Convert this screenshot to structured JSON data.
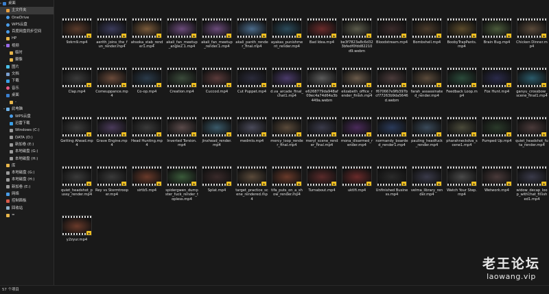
{
  "sidebar": {
    "items": [
      {
        "label": "桌面",
        "icon": "desktop-icon",
        "indent": 0,
        "selected": false,
        "expanded": true
      },
      {
        "label": "主文件夹",
        "icon": "home-folder-icon",
        "indent": 1,
        "selected": true
      },
      {
        "label": "OneDrive",
        "icon": "cloud-icon",
        "indent": 1,
        "selected": false
      },
      {
        "label": "WPS云盘",
        "icon": "cloud-icon",
        "indent": 1,
        "selected": false
      },
      {
        "label": "百度网盘同步空间",
        "icon": "cloud-icon",
        "indent": 1,
        "selected": false
      },
      {
        "label": "HP",
        "icon": "user-folder-icon",
        "indent": 1,
        "selected": false
      },
      {
        "label": "视频",
        "icon": "video-folder-icon",
        "indent": 1,
        "selected": false,
        "expanded": true
      },
      {
        "label": "临时",
        "icon": "folder-icon",
        "indent": 2,
        "selected": false
      },
      {
        "label": "摄像",
        "icon": "folder-icon",
        "indent": 2,
        "selected": false
      },
      {
        "label": "图片",
        "icon": "pictures-icon",
        "indent": 1,
        "selected": false
      },
      {
        "label": "文档",
        "icon": "documents-icon",
        "indent": 1,
        "selected": false
      },
      {
        "label": "下载",
        "icon": "download-icon",
        "indent": 1,
        "selected": false
      },
      {
        "label": "音乐",
        "icon": "music-icon",
        "indent": 1,
        "selected": false
      },
      {
        "label": "桌面",
        "icon": "desktop-icon",
        "indent": 1,
        "selected": false
      },
      {
        "label": "-",
        "icon": "folder-icon",
        "indent": 2,
        "selected": false
      },
      {
        "label": "此电脑",
        "icon": "computer-icon",
        "indent": 1,
        "selected": false,
        "expanded": true
      },
      {
        "label": "WPS云盘",
        "icon": "cloud-icon",
        "indent": 2,
        "selected": false
      },
      {
        "label": "迅雷下载",
        "icon": "download-icon",
        "indent": 2,
        "selected": false
      },
      {
        "label": "Windows (C:)",
        "icon": "drive-icon",
        "indent": 2,
        "selected": false
      },
      {
        "label": "DATA (D:)",
        "icon": "drive-icon",
        "indent": 2,
        "selected": false
      },
      {
        "label": "新加卷 (E:)",
        "icon": "drive-icon",
        "indent": 2,
        "selected": false
      },
      {
        "label": "本地磁盘 (G:)",
        "icon": "drive-icon",
        "indent": 2,
        "selected": false
      },
      {
        "label": "本地磁盘 (H:)",
        "icon": "drive-icon",
        "indent": 2,
        "selected": false
      },
      {
        "label": "库",
        "icon": "library-icon",
        "indent": 1,
        "selected": false
      },
      {
        "label": "本地磁盘 (G:)",
        "icon": "drive-icon",
        "indent": 1,
        "selected": false
      },
      {
        "label": "本地磁盘 (H:)",
        "icon": "drive-icon",
        "indent": 1,
        "selected": false
      },
      {
        "label": "新加卷 (E:)",
        "icon": "drive-icon",
        "indent": 1,
        "selected": false
      },
      {
        "label": "网络",
        "icon": "network-icon",
        "indent": 1,
        "selected": false
      },
      {
        "label": "控制面板",
        "icon": "control-panel-icon",
        "indent": 1,
        "selected": false
      },
      {
        "label": "回收站",
        "icon": "recycle-bin-icon",
        "indent": 1,
        "selected": false
      },
      {
        "label": "=",
        "icon": "folder-icon",
        "indent": 1,
        "selected": false
      }
    ]
  },
  "files": [
    {
      "name": "9zkrn9.mp4",
      "tint": "#5a3a2a"
    },
    {
      "name": "aerith_joins_the_fun_render.mp4",
      "tint": "#3a3a5a"
    },
    {
      "name": "ahsoka_stab_render1.mp4",
      "tint": "#7a5a3a"
    },
    {
      "name": "akali_fan_meetup_angle2.1.mp4",
      "tint": "#6a4a7a"
    },
    {
      "name": "akali_fan_meetup_render.1.mp4",
      "tint": "#6a4a7a"
    },
    {
      "name": "akali_panth_render_final.mp4",
      "tint": "#4a6a8a"
    },
    {
      "name": "ayakas_punishment_render.mp4",
      "tint": "#2a4a5a"
    },
    {
      "name": "Bad Idea.mp4",
      "tint": "#6a2a2a"
    },
    {
      "name": "be3f7823a8c6d323bfedf0fdd82210d9.webm",
      "tint": "#5a5a4a"
    },
    {
      "name": "Bloodstream.mp4",
      "tint": "#3a2a2a"
    },
    {
      "name": "Bombshell.mp4",
      "tint": "#4a3a2a"
    },
    {
      "name": "BoobyTrapPants.mp4",
      "tint": "#5a4a2a"
    },
    {
      "name": "Brain Bug.mp4",
      "tint": "#4a5a3a"
    },
    {
      "name": "Chicken Dinner.mp4",
      "tint": "#5a4a3a"
    },
    {
      "name": "Clap.mp4",
      "tint": "#3a3a3a"
    },
    {
      "name": "Comeuppance.mp4",
      "tint": "#6a4a3a"
    },
    {
      "name": "Co-op.mp4",
      "tint": "#2a3a4a"
    },
    {
      "name": "Creation.mp4",
      "tint": "#3a4a3a"
    },
    {
      "name": "Cuccod.mp4",
      "tint": "#5a3a3a"
    },
    {
      "name": "Cut Puppet.mp4",
      "tint": "#2a2a3a"
    },
    {
      "name": "d.va_arcade_final_chat1.mp4",
      "tint": "#4a3a6a"
    },
    {
      "name": "e6268779da948af09ec4a74d64a3b449a.webm",
      "tint": "#5a5a5a"
    },
    {
      "name": "elizabeth_office_render_finish.mp4",
      "tint": "#6a5a4a"
    },
    {
      "name": "f670667e9fb397bcf77263b9da5646d.webm",
      "tint": "#4a3a3a"
    },
    {
      "name": "farah_assassinated_render.mp4",
      "tint": "#5a4a3a"
    },
    {
      "name": "Feedback Loop.mp4",
      "tint": "#2a4a3a"
    },
    {
      "name": "Fox Hunt.mp4",
      "tint": "#2a2a4a"
    },
    {
      "name": "ganyu_crossbow_scene_final1.mp4",
      "tint": "#2a5a6a"
    },
    {
      "name": "Getting Ahead.mp4",
      "tint": "#3a3a3a"
    },
    {
      "name": "Grave Engine.mp4",
      "tint": "#4a3a5a"
    },
    {
      "name": "Head Hunting.mp4",
      "tint": "#3a3a3a"
    },
    {
      "name": "Inverted Torsion.mp4",
      "tint": "#5a4a4a"
    },
    {
      "name": "jinxhead_render.mp4",
      "tint": "#3a5a6a"
    },
    {
      "name": "medmlo.mp4",
      "tint": "#4a4a5a"
    },
    {
      "name": "mercy_loop_render_final.mp4",
      "tint": "#5a4a3a"
    },
    {
      "name": "meryl_scene_render_final.mp4",
      "tint": "#3a3a4a"
    },
    {
      "name": "mona_disarmed_render.mp4",
      "tint": "#4a2a5a"
    },
    {
      "name": "normandy_boarded_render1.mp4",
      "tint": "#2a3a5a"
    },
    {
      "name": "pauling_headfuck_render.mp4",
      "tint": "#3a4a5a"
    },
    {
      "name": "pharahneckdva_scene1.mp4",
      "tint": "#4a4a3a"
    },
    {
      "name": "Pumped Up.mp4",
      "tint": "#2a3a2a"
    },
    {
      "name": "quiet_headshot_futa_render.mp4",
      "tint": "#4a3a3a"
    },
    {
      "name": "quiet_headshot_pussy_render.mp4",
      "tint": "#3a3a3a"
    },
    {
      "name": "Rey vs Stormtrooper.mp4",
      "tint": "#3a3a3a"
    },
    {
      "name": "sirtb5.mp4",
      "tint": "#6a3a2a"
    },
    {
      "name": "spidergwen_dumpster_fuck_render_topless.mp4",
      "tint": "#3a5a3a"
    },
    {
      "name": "Splat.mp4",
      "tint": "#3a2a2a"
    },
    {
      "name": "target_practice_scene_rendered.mp4",
      "tint": "#5a4a3a"
    },
    {
      "name": "tifa_puts_on_a_show_render.mp4",
      "tint": "#6a3a2a"
    },
    {
      "name": "Turnabout.mp4",
      "tint": "#5a2a2a"
    },
    {
      "name": "uktlfi.mp4",
      "tint": "#6a2a2a"
    },
    {
      "name": "Unfinished Business.mp4",
      "tint": "#2a2a2a"
    },
    {
      "name": "velma_library_render.mp4",
      "tint": "#3a3a4a"
    },
    {
      "name": "Watch Your Step.mp4",
      "tint": "#4a4a4a"
    },
    {
      "name": "Wetwork.mp4",
      "tint": "#4a3a3a"
    },
    {
      "name": "widow_decap_loop_withchat_finished1.mp4",
      "tint": "#3a3a4a"
    },
    {
      "name": "y2zyur.mp4",
      "tint": "#6a3a2a"
    }
  ],
  "statusbar": {
    "text": "57 个项目"
  },
  "watermark": {
    "title": "老王论坛",
    "url": "laowang.vip"
  },
  "colors": {
    "background": "#191919",
    "selected": "#3a3a3a",
    "badge": "#f0c020"
  }
}
